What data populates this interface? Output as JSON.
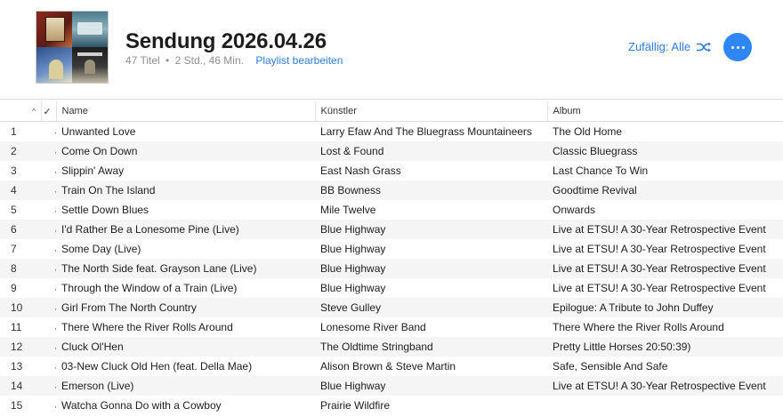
{
  "playlist": {
    "title": "Sendung 2026.04.26",
    "track_count": "47 Titel",
    "separator": "•",
    "duration": "2 Std., 46 Min.",
    "edit_label": "Playlist bearbeiten"
  },
  "controls": {
    "shuffle_label": "Zufällig: Alle",
    "shuffle_icon": "shuffle-icon",
    "more_icon": "more-icon",
    "accent": "#2c7be5"
  },
  "table": {
    "sort_indicator": "^",
    "check_header": "✓",
    "columns": {
      "name": "Name",
      "artist": "Künstler",
      "album": "Album"
    },
    "rows": [
      {
        "num": "1",
        "checked": "✓",
        "name": "Unwanted Love",
        "artist": "Larry Efaw And The Bluegrass Mountaineers",
        "album": "The Old Home"
      },
      {
        "num": "2",
        "checked": "✓",
        "name": "Come On Down",
        "artist": "Lost & Found",
        "album": "Classic Bluegrass"
      },
      {
        "num": "3",
        "checked": "✓",
        "name": "Slippin' Away",
        "artist": "East Nash Grass",
        "album": "Last Chance To Win"
      },
      {
        "num": "4",
        "checked": "✓",
        "name": "Train On The Island",
        "artist": "BB Bowness",
        "album": "Goodtime Revival"
      },
      {
        "num": "5",
        "checked": "✓",
        "name": "Settle Down Blues",
        "artist": "Mile Twelve",
        "album": "Onwards"
      },
      {
        "num": "6",
        "checked": "✓",
        "name": "I'd Rather Be a Lonesome Pine (Live)",
        "artist": "Blue Highway",
        "album": "Live at ETSU! A 30-Year Retrospective Event"
      },
      {
        "num": "7",
        "checked": "✓",
        "name": "Some Day (Live)",
        "artist": "Blue Highway",
        "album": "Live at ETSU! A 30-Year Retrospective Event"
      },
      {
        "num": "8",
        "checked": "✓",
        "name": "The North Side feat. Grayson Lane (Live)",
        "artist": "Blue Highway",
        "album": "Live at ETSU! A 30-Year Retrospective Event"
      },
      {
        "num": "9",
        "checked": "✓",
        "name": "Through the Window of a Train (Live)",
        "artist": "Blue Highway",
        "album": "Live at ETSU! A 30-Year Retrospective Event"
      },
      {
        "num": "10",
        "checked": "✓",
        "name": "Girl From The North Country",
        "artist": "Steve Gulley",
        "album": "Epilogue: A Tribute to John Duffey"
      },
      {
        "num": "11",
        "checked": "✓",
        "name": "There Where the River Rolls Around",
        "artist": "Lonesome River Band",
        "album": "There Where the River Rolls Around"
      },
      {
        "num": "12",
        "checked": "✓",
        "name": "Cluck Ol'Hen",
        "artist": "The Oldtime Stringband",
        "album": "Pretty Little Horses 20:50:39)"
      },
      {
        "num": "13",
        "checked": "✓",
        "name": "03-New Cluck Old Hen (feat. Della Mae)",
        "artist": "Alison Brown & Steve Martin",
        "album": "Safe, Sensible And Safe"
      },
      {
        "num": "14",
        "checked": "✓",
        "name": "Emerson (Live)",
        "artist": "Blue Highway",
        "album": "Live at ETSU! A 30-Year Retrospective Event"
      },
      {
        "num": "15",
        "checked": "✓",
        "name": "Watcha Gonna Do with a Cowboy",
        "artist": "Prairie Wildfire",
        "album": ""
      }
    ]
  }
}
